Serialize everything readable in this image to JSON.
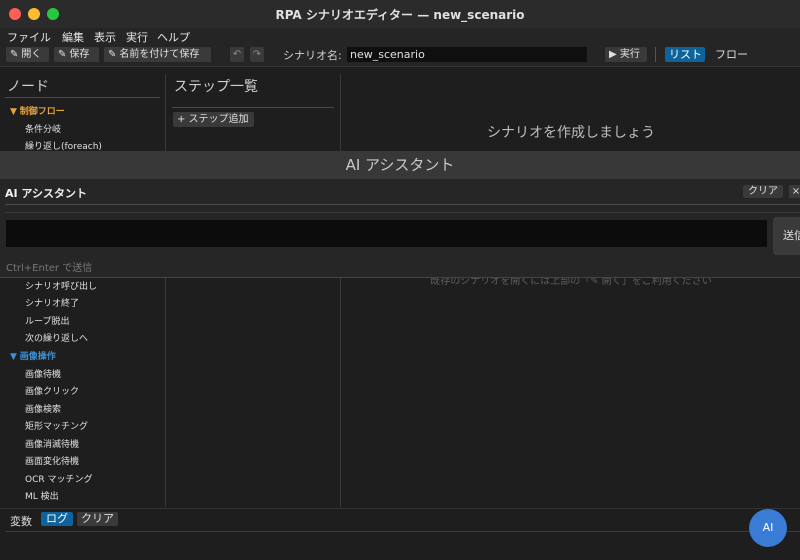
{
  "window": {
    "title": "RPA シナリオエディター — new_scenario"
  },
  "menubar": {
    "items": [
      "ファイル",
      "編集",
      "表示",
      "実行",
      "ヘルプ"
    ]
  },
  "toolbar": {
    "open_label": "開く",
    "save_label": "保存",
    "save_as_label": "名前を付けて保存",
    "undo_label": "↶",
    "redo_label": "↷",
    "scenario_name_label": "シナリオ名:",
    "scenario_name_value": "new_scenario",
    "run_label": "▶ 実行",
    "view_list_label": "リスト",
    "view_flow_label": "フロー"
  },
  "nodes_panel": {
    "title": "ノード",
    "top_category": {
      "label": "制御フロー",
      "color": "#e8a33c"
    },
    "top_items": [
      "条件分岐",
      "繰り返し(foreach)"
    ],
    "hidden_items": [
      "シナリオ呼び出し",
      "シナリオ終了",
      "ループ脱出",
      "次の繰り返しへ"
    ],
    "image_category": {
      "label": "画像操作",
      "color": "#3d8fd6"
    },
    "image_items": [
      "画像待機",
      "画像クリック",
      "画像検索",
      "矩形マッチング",
      "画像消滅待機",
      "画面変化待機",
      "OCR マッチング",
      "ML 検出"
    ]
  },
  "steps_panel": {
    "title": "ステップ一覧",
    "add_button": "+ ステップ追加"
  },
  "main_area": {
    "heading": "シナリオを作成しましょう",
    "hint": "既存のシナリオを開くには上部の「✎ 開く」をご利用ください"
  },
  "ai_dialog": {
    "window_title": "AI アシスタント",
    "panel_title": "AI アシスタント",
    "clear_label": "クリア",
    "close_label": "×",
    "input_value": "",
    "send_label": "送信",
    "hint": "Ctrl+Enter で送信"
  },
  "bottom_bar": {
    "tabs": [
      "変数",
      "ログ",
      "クリア"
    ],
    "ai_button": "AI"
  },
  "colors": {
    "accent": "#0e639c",
    "control_flow": "#e8a33c",
    "image_ops": "#3d8fd6",
    "ai_button": "#3a7bd5"
  }
}
